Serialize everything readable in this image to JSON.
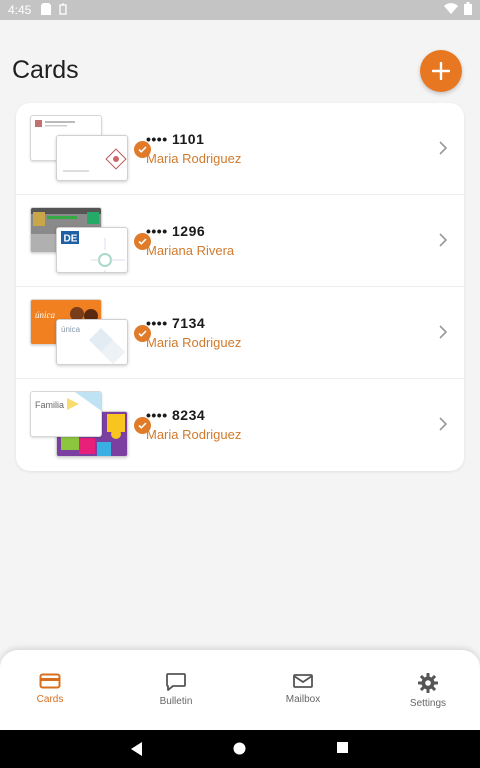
{
  "status_bar": {
    "time": "4:45"
  },
  "header": {
    "title": "Cards"
  },
  "cards": [
    {
      "number": "•••• 1101",
      "holder": "Maria Rodriguez"
    },
    {
      "number": "•••• 1296",
      "holder": "Mariana Rivera"
    },
    {
      "number": "•••• 7134",
      "holder": "Maria Rodriguez"
    },
    {
      "number": "•••• 8234",
      "holder": "Maria Rodriguez"
    }
  ],
  "card_thumbs": {
    "c2_front_logo": "DE",
    "c3_back_logo": "única",
    "c3_front_logo": "única",
    "c4_back_logo": "Familia"
  },
  "bottom_nav": {
    "items": [
      {
        "label": "Cards",
        "icon": "credit-card-icon",
        "active": true
      },
      {
        "label": "Bulletin",
        "icon": "chat-bubble-icon",
        "active": false
      },
      {
        "label": "Mailbox",
        "icon": "envelope-icon",
        "active": false
      },
      {
        "label": "Settings",
        "icon": "gear-icon",
        "active": false
      }
    ]
  },
  "colors": {
    "accent": "#e87722",
    "holder_text": "#d07a2e",
    "status_bar": "#c4c4c4"
  }
}
